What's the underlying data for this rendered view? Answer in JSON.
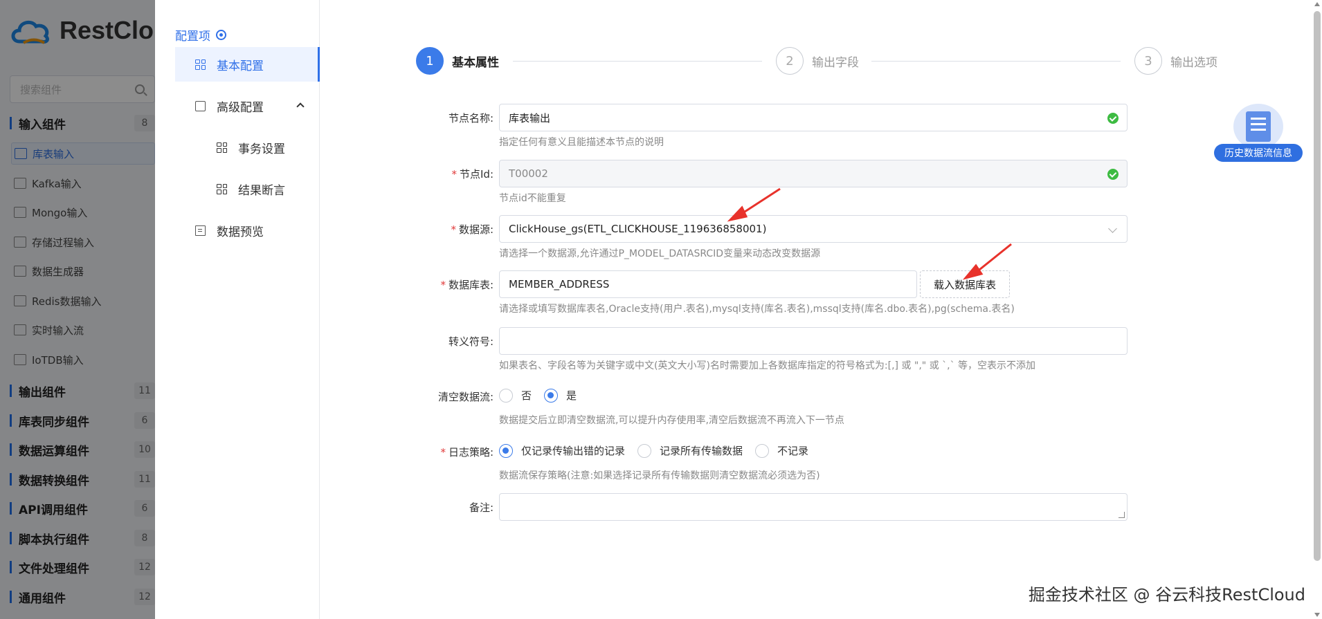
{
  "background_palette": {
    "brand": "RestClo",
    "search_placeholder": "搜索组件",
    "groups": [
      {
        "name": "输入组件",
        "count": "8"
      },
      {
        "name": "输出组件",
        "count": "11"
      },
      {
        "name": "库表同步组件",
        "count": "6"
      },
      {
        "name": "数据运算组件",
        "count": "10"
      },
      {
        "name": "数据转换组件",
        "count": "11"
      },
      {
        "name": "API调用组件",
        "count": "6"
      },
      {
        "name": "脚本执行组件",
        "count": "8"
      },
      {
        "name": "文件处理组件",
        "count": "12"
      },
      {
        "name": "通用组件",
        "count": "12"
      }
    ],
    "input_items": [
      "库表输入",
      "Kafka输入",
      "Mongo输入",
      "存储过程输入",
      "数据生成器",
      "Redis数据输入",
      "实时输入流",
      "IoTDB输入"
    ]
  },
  "sidenav": {
    "title": "配置项",
    "items": [
      {
        "label": "基本配置"
      },
      {
        "label": "高级配置"
      },
      {
        "label": "事务设置"
      },
      {
        "label": "结果断言"
      },
      {
        "label": "数据预览"
      }
    ]
  },
  "steps": [
    {
      "num": "1",
      "label": "基本属性"
    },
    {
      "num": "2",
      "label": "输出字段"
    },
    {
      "num": "3",
      "label": "输出选项"
    }
  ],
  "form": {
    "node_name": {
      "label": "节点名称:",
      "value": "库表输出",
      "help": "指定任何有意义且能描述本节点的说明"
    },
    "node_id": {
      "label": "节点Id:",
      "value": "T00002",
      "help": "节点id不能重复"
    },
    "datasource": {
      "label": "数据源:",
      "value": "ClickHouse_gs(ETL_CLICKHOUSE_119636858001)",
      "help": "请选择一个数据源,允许通过P_MODEL_DATASRCID变量来动态改变数据源"
    },
    "table": {
      "label": "数据库表:",
      "value": "MEMBER_ADDRESS",
      "button": "载入数据库表",
      "help": "请选择或填写数据库表名,Oracle支持(用户.表名),mysql支持(库名.表名),mssql支持(库名.dbo.表名),pg(schema.表名)"
    },
    "escape": {
      "label": "转义符号:",
      "value": "",
      "help": "如果表名、字段名等为关键字或中文(英文大小写)名时需要加上各数据库指定的符号格式为:[,] 或 \",\" 或 `,` 等，空表示不添加"
    },
    "clear_stream": {
      "label": "清空数据流:",
      "options": [
        "否",
        "是"
      ],
      "selected": "是",
      "help": "数据提交后立即清空数据流,可以提升内存使用率,清空后数据流不再流入下一节点"
    },
    "log_policy": {
      "label": "日志策略:",
      "options": [
        "仅记录传输出错的记录",
        "记录所有传输数据",
        "不记录"
      ],
      "selected": "仅记录传输出错的记录",
      "help": "数据流保存策略(注意:如果选择记录所有传输数据则清空数据流必须选为否)"
    },
    "remark": {
      "label": "备注:",
      "value": ""
    }
  },
  "history_label": "历史数据流信息",
  "watermark": "掘金技术社区 @ 谷云科技RestCloud",
  "colors": {
    "primary": "#3b7be9",
    "required": "#e03a3a",
    "success": "#3dbb42",
    "annotation": "#e8322b"
  }
}
